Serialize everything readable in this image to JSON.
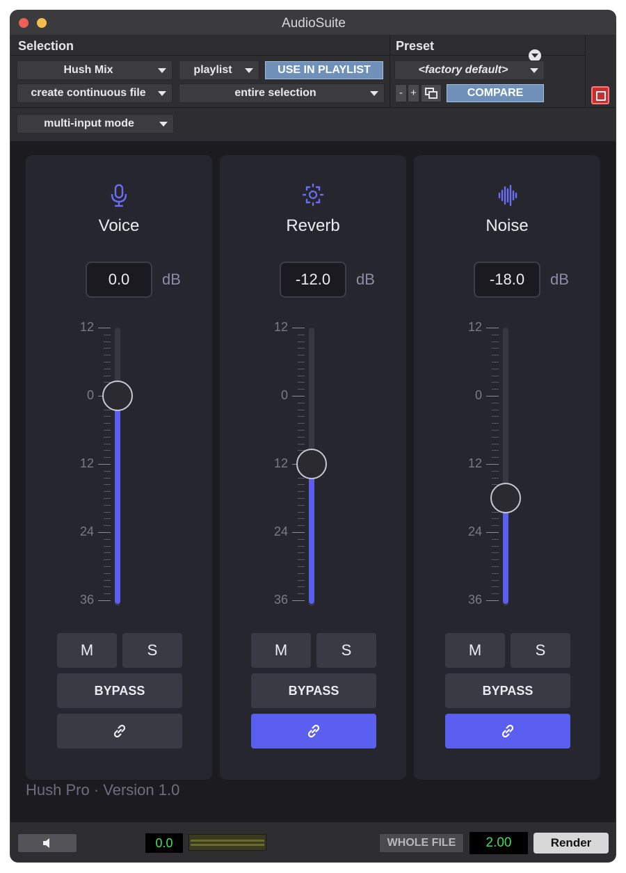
{
  "window": {
    "title": "AudioSuite"
  },
  "header": {
    "selection_label": "Selection",
    "preset_label": "Preset",
    "plugin_select": "Hush Mix",
    "playlist_select": "playlist",
    "use_in_playlist": "USE IN PLAYLIST",
    "processing_select": "create continuous file",
    "range_select": "entire selection",
    "input_mode_select": "multi-input mode",
    "preset_select": "<factory default>",
    "preset_minus": "-",
    "preset_plus": "+",
    "compare": "COMPARE"
  },
  "fader_scale": [
    "12",
    "0",
    "12",
    "24",
    "36"
  ],
  "channels": [
    {
      "name": "Voice",
      "icon": "microphone-icon",
      "value": "0.0",
      "unit": "dB",
      "fader_level": 0,
      "mute": "M",
      "solo": "S",
      "bypass": "BYPASS",
      "link_active": false
    },
    {
      "name": "Reverb",
      "icon": "reverb-icon",
      "value": "-12.0",
      "unit": "dB",
      "fader_level": -12,
      "mute": "M",
      "solo": "S",
      "bypass": "BYPASS",
      "link_active": true
    },
    {
      "name": "Noise",
      "icon": "waveform-icon",
      "value": "-18.0",
      "unit": "dB",
      "fader_level": -18,
      "mute": "M",
      "solo": "S",
      "bypass": "BYPASS",
      "link_active": true
    }
  ],
  "footer": {
    "version": "Hush Pro · Version 1.0"
  },
  "bottom": {
    "meter_value": "0.0",
    "whole_file": "WHOLE FILE",
    "handle_value": "2.00",
    "render": "Render"
  },
  "colors": {
    "accent": "#5b5ff0",
    "compare": "#6f90b9",
    "meter_text": "#3ee05a"
  }
}
